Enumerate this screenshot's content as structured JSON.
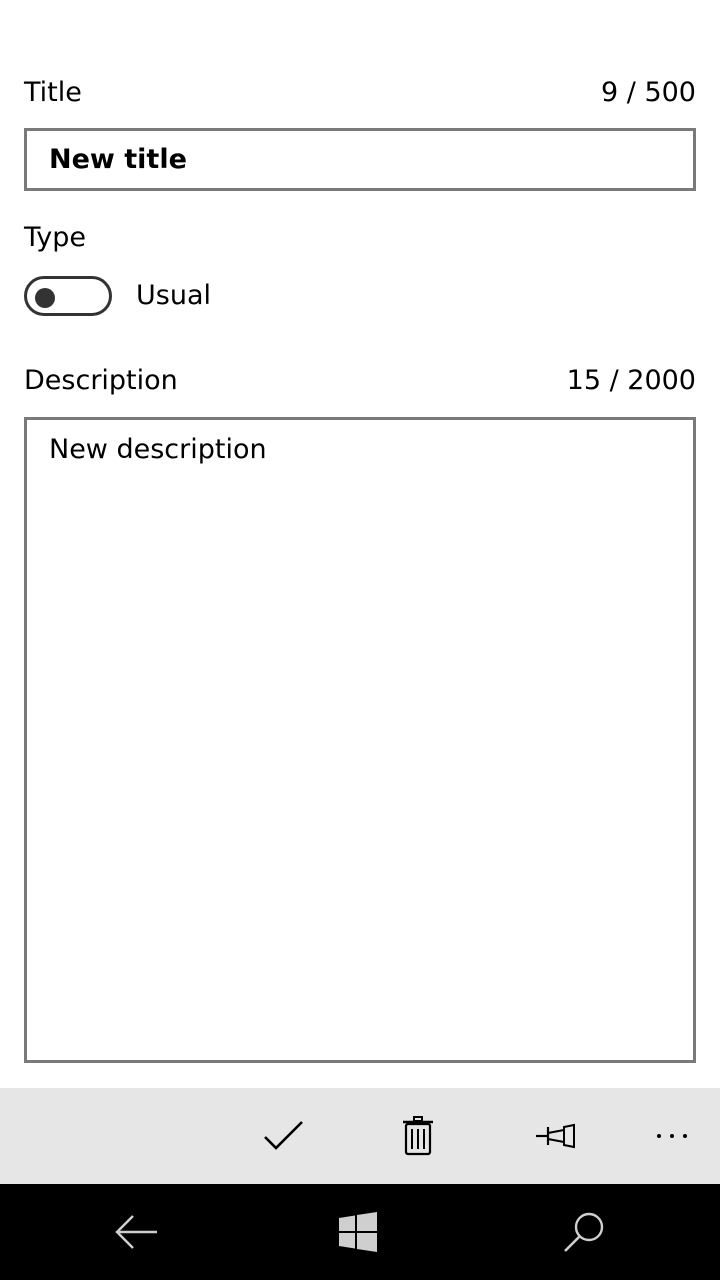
{
  "form": {
    "title": {
      "label": "Title",
      "counter": "9 / 500",
      "value": "New title"
    },
    "type": {
      "label": "Type",
      "toggle_text": "Usual",
      "toggle_on": false
    },
    "description": {
      "label": "Description",
      "counter": "15 / 2000",
      "value": "New description"
    }
  },
  "app_bar": {
    "background": "#e6e6e6",
    "buttons": [
      {
        "icon": "checkmark-icon"
      },
      {
        "icon": "trash-icon"
      },
      {
        "icon": "pin-icon"
      },
      {
        "icon": "more-icon",
        "glyph": "..."
      }
    ]
  },
  "nav_bar": {
    "background": "#000000",
    "buttons": [
      {
        "icon": "back-arrow-icon"
      },
      {
        "icon": "windows-start-icon"
      },
      {
        "icon": "search-icon"
      }
    ]
  }
}
